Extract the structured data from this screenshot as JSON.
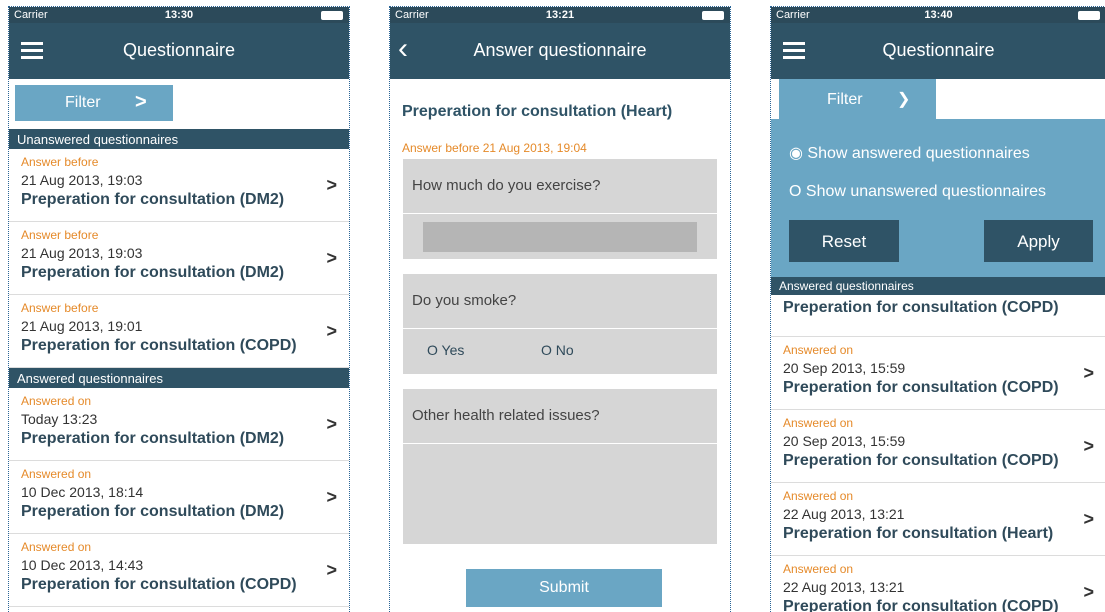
{
  "status": {
    "carrier": "Carrier",
    "times": [
      "13:30",
      "13:21",
      "13:40"
    ]
  },
  "screen1": {
    "title": "Questionnaire",
    "filter_label": "Filter",
    "unanswered_header": "Unanswered questionnaires",
    "unanswered": [
      {
        "label": "Answer before",
        "date": "21 Aug 2013, 19:03",
        "name": "Preperation for consultation (DM2)"
      },
      {
        "label": "Answer before",
        "date": "21 Aug 2013, 19:03",
        "name": "Preperation for consultation (DM2)"
      },
      {
        "label": "Answer before",
        "date": "21 Aug 2013, 19:01",
        "name": "Preperation for consultation (COPD)"
      }
    ],
    "answered_header": "Answered questionnaires",
    "answered": [
      {
        "label": "Answered on",
        "date": "Today 13:23",
        "name": "Preperation for consultation (DM2)"
      },
      {
        "label": "Answered on",
        "date": "10 Dec 2013, 18:14",
        "name": "Preperation for consultation (DM2)"
      },
      {
        "label": "Answered on",
        "date": "10 Dec 2013, 14:43",
        "name": "Preperation for consultation (COPD)"
      }
    ]
  },
  "screen2": {
    "title": "Answer questionnaire",
    "form_title": "Preperation for consultation (Heart)",
    "answer_before": "Answer before 21 Aug 2013, 19:04",
    "q1": "How much do you exercise?",
    "q2": "Do you smoke?",
    "yes": "O Yes",
    "no": "O No",
    "q3": "Other health related issues?",
    "submit": "Submit"
  },
  "screen3": {
    "title": "Questionnaire",
    "filter_label": "Filter",
    "opt_answered": "◉  Show answered questionnaires",
    "opt_unanswered": "O   Show unanswered questionnaires",
    "reset": "Reset",
    "apply": "Apply",
    "answered_header": "Answered questionnaires",
    "first_item": "Preperation for consultation (COPD)",
    "items": [
      {
        "label": "Answered on",
        "date": "20 Sep 2013, 15:59",
        "name": "Preperation for consultation (COPD)"
      },
      {
        "label": "Answered on",
        "date": "20 Sep 2013, 15:59",
        "name": "Preperation for consultation (COPD)"
      },
      {
        "label": "Answered on",
        "date": "22 Aug 2013, 13:21",
        "name": "Preperation for consultation (Heart)"
      },
      {
        "label": "Answered on",
        "date": "22 Aug 2013, 13:21",
        "name": "Preperation for consultation (COPD)"
      }
    ]
  }
}
